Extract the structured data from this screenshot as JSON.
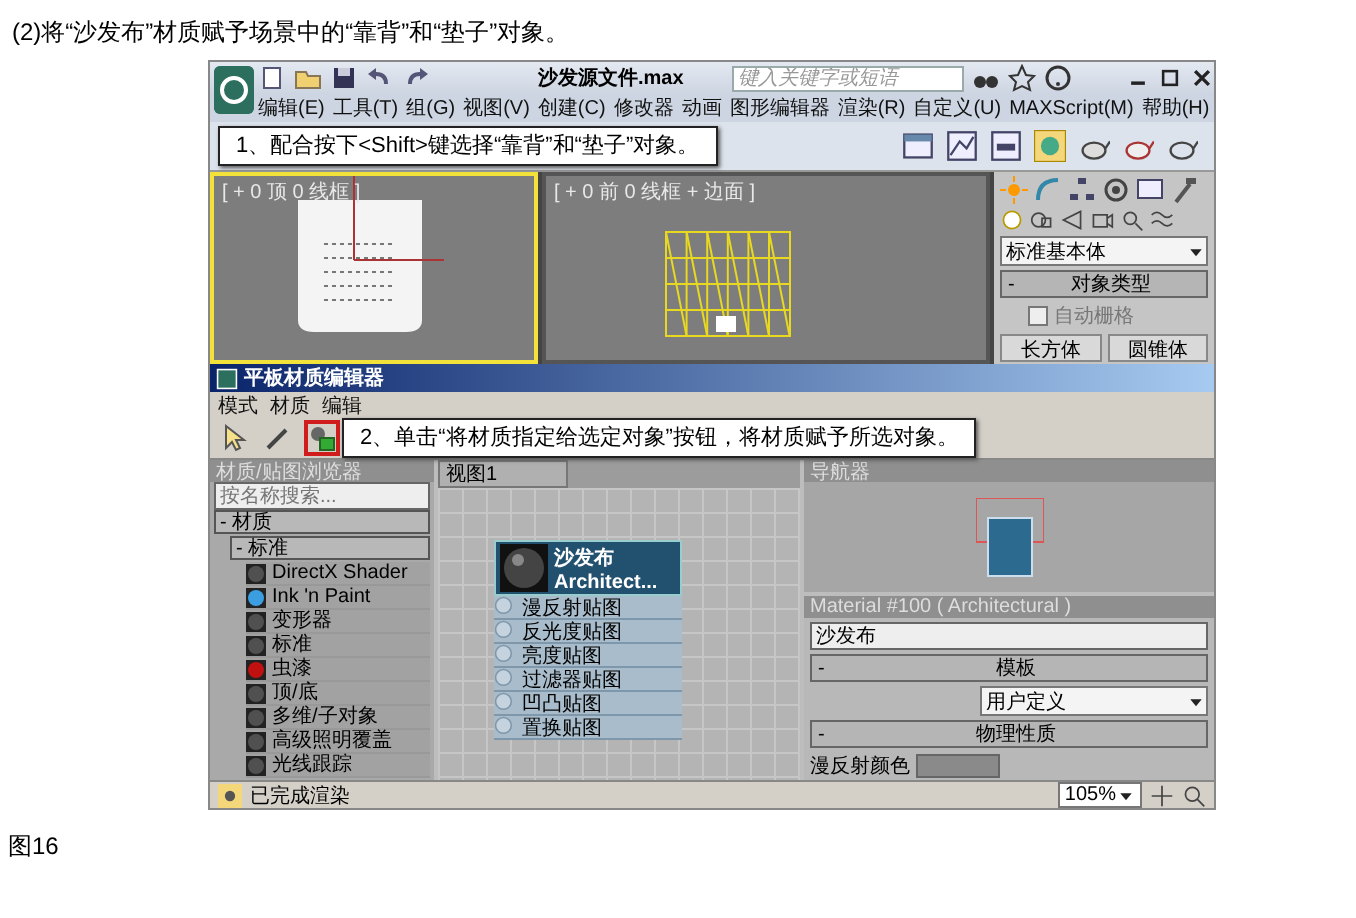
{
  "caption": "(2)将“沙发布”材质赋予场景中的“靠背”和“垫子”对象。",
  "app": {
    "title": "沙发源文件.max",
    "search": {
      "placeholder": "键入关键字或短语"
    },
    "menu": [
      "编辑(E)",
      "工具(T)",
      "组(G)",
      "视图(V)",
      "创建(C)",
      "修改器",
      "动画",
      "图形编辑器",
      "渲染(R)",
      "自定义(U)",
      "MAXScript(M)",
      "帮助(H)"
    ],
    "callouts": [
      "1、配合按下<Shift>键选择“靠背”和“垫子”对象。",
      "2、单击“将材质指定给选定对象”按钮，将材质赋予所选对象。"
    ],
    "viewports": [
      {
        "label": "[ + 0 顶 0 线框 ]",
        "active": true,
        "kind": "top"
      },
      {
        "label": "[ + 0 前 0 线框 + 边面 ]",
        "active": false,
        "kind": "front"
      }
    ],
    "command_panel": {
      "dropdown": "标准基本体",
      "rollout": {
        "toggle": "-",
        "title": "对象类型"
      },
      "autogrid": {
        "label": "自动栅格",
        "checked": false
      },
      "buttons": [
        "长方体",
        "圆锥体"
      ]
    },
    "slate": {
      "title": "平板材质编辑器",
      "menu": [
        "模式",
        "材质",
        "编辑"
      ],
      "tools": [
        {
          "kind": "select",
          "highlighted": false
        },
        {
          "kind": "eyedropper",
          "highlighted": false
        },
        {
          "kind": "assign",
          "highlighted": true
        }
      ],
      "browser": {
        "title": "材质/贴图浏览器",
        "search": {
          "placeholder": "按名称搜索..."
        },
        "tree": [
          {
            "label": "- 材质",
            "children": [
              {
                "label": "- 标准",
                "children": [
                  {
                    "label": "DirectX Shader",
                    "color": "#505050"
                  },
                  {
                    "label": "Ink 'n Paint",
                    "color": "#3a9ee0"
                  },
                  {
                    "label": "变形器",
                    "color": "#505050"
                  },
                  {
                    "label": "标准",
                    "color": "#505050"
                  },
                  {
                    "label": "虫漆",
                    "color": "#c01010"
                  },
                  {
                    "label": "顶/底",
                    "color": "#505050"
                  },
                  {
                    "label": "多维/子对象",
                    "color": "#505050"
                  },
                  {
                    "label": "高级照明覆盖",
                    "color": "#505050"
                  },
                  {
                    "label": "光线跟踪",
                    "color": "#505050"
                  }
                ]
              }
            ]
          }
        ]
      },
      "view": {
        "tab": "视图1",
        "node": {
          "title": "沙发布",
          "subtitle": "Architect...",
          "slots": [
            "漫反射贴图",
            "反光度贴图",
            "亮度贴图",
            "过滤器贴图",
            "凹凸贴图",
            "置换贴图"
          ]
        }
      },
      "navigator": {
        "title": "导航器"
      },
      "params": {
        "title": "Material #100 ( Architectural )",
        "name": "沙发布",
        "rollouts": [
          {
            "toggle": "-",
            "title": "模板",
            "dropdown": "用户定义"
          },
          {
            "toggle": "-",
            "title": "物理性质",
            "label": "漫反射颜色"
          }
        ]
      },
      "status": {
        "text": "已完成渲染",
        "zoom": "105%"
      }
    }
  },
  "figure_label": "图16"
}
